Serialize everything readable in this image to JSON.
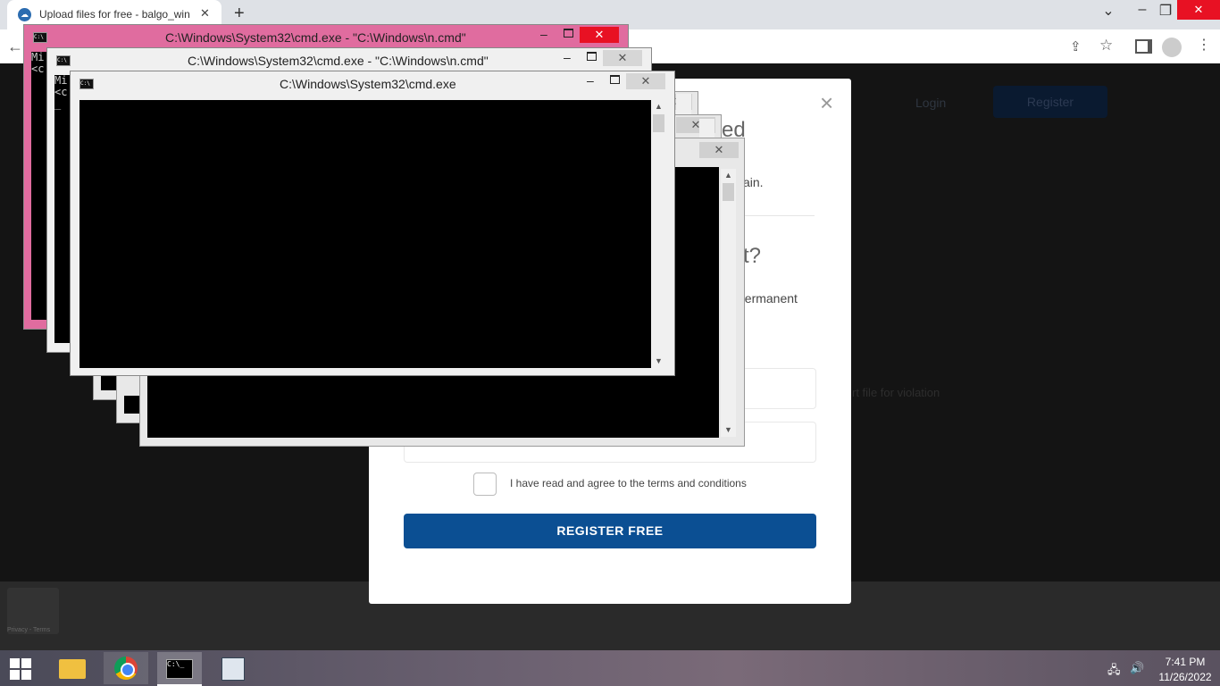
{
  "browser": {
    "tab_title": "Upload files for free - balgo_win",
    "tab_favicon": "cloud-icon",
    "new_tab": "+",
    "close_tab": "✕"
  },
  "page": {
    "nav_login": "Login",
    "nav_register": "Register",
    "bg_text": "rt file for violation",
    "recaptcha_text": "Privacy - Terms"
  },
  "modal": {
    "close": "×",
    "fragment_heading1": "ed",
    "fragment_text1": "ain.",
    "fragment_heading2": "t?",
    "fragment_text2": "permanent",
    "agree_label": "I have read and agree to the terms and conditions",
    "register_button": "REGISTER FREE"
  },
  "cmd_windows": [
    {
      "title": "C:\\Windows\\System32\\cmd.exe - \"C:\\Windows\\n.cmd\"",
      "console_text": "Mi\n<c",
      "active_color": "#e06c9f"
    },
    {
      "title": "C:\\Windows\\System32\\cmd.exe - \"C:\\Windows\\n.cmd\"",
      "console_text": "Mi\n<c\n_"
    },
    {
      "title": "C:\\Windows\\System32\\cmd.exe",
      "console_text": ""
    }
  ],
  "window_controls": {
    "minimize": "–",
    "close": "✕"
  },
  "taskbar": {
    "apps": [
      "file-explorer-icon",
      "chrome-icon",
      "cmd-icon",
      "notepad-icon"
    ],
    "time": "7:41 PM",
    "date": "11/26/2022"
  }
}
